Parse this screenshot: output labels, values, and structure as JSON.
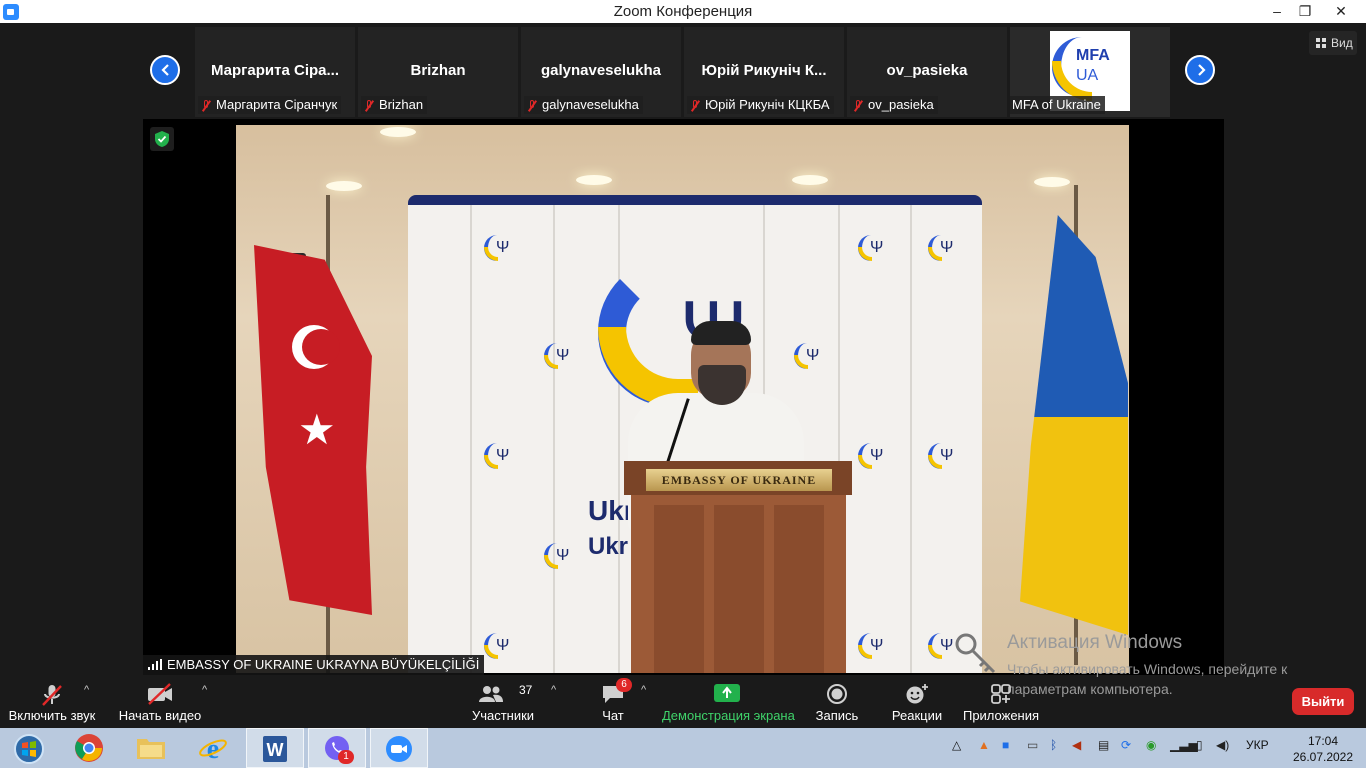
{
  "window": {
    "title": "Zoom Конференция",
    "minimize": "–",
    "maximize": "❐",
    "close": "✕"
  },
  "view_button": {
    "label": "Вид"
  },
  "thumbnails": [
    {
      "name": "Маргарита  Сіра...",
      "label": "Маргарита Сіранчук",
      "muted": true
    },
    {
      "name": "Brizhan",
      "label": "Brizhan",
      "muted": true
    },
    {
      "name": "galynaveselukha",
      "label": "galynaveselukha",
      "muted": true
    },
    {
      "name": "Юрій  Рикуніч  К...",
      "label": "Юрій Рикуніч КЦКБА",
      "muted": true
    },
    {
      "name": "ov_pasieka",
      "label": "ov_pasieka",
      "muted": true
    },
    {
      "name": "",
      "label": "MFA of Ukraine",
      "muted": false,
      "logo_text_1": "MFA",
      "logo_text_2": "UA"
    }
  ],
  "main_video": {
    "speaker_label": "EMBASSY OF UKRAINE UKRAYNA BÜYÜKELÇİLİĞİ",
    "podium_plate": "EMBASSY OF UKRAINE",
    "backdrop_text_1": "Ukra",
    "backdrop_text_1b": "Y",
    "backdrop_text_2": "Ukr"
  },
  "activation": {
    "title": "Активация Windows",
    "message": "Чтобы активировать Windows, перейдите к параметрам компьютера."
  },
  "toolbar": {
    "unmute": "Включить звук",
    "start_video": "Начать видео",
    "participants": "Участники",
    "participants_count": "37",
    "chat": "Чат",
    "chat_badge": "6",
    "share": "Демонстрация экрана",
    "record": "Запись",
    "reactions": "Реакции",
    "apps": "Приложения",
    "leave": "Выйти"
  },
  "taskbar": {
    "lang": "УКР",
    "time": "17:04",
    "date": "26.07.2022",
    "viber_badge": "1"
  },
  "colors": {
    "zoom_blue": "#2d8cff",
    "leave_red": "#d82a2a",
    "share_green": "#22b14c",
    "mute_red": "#e02828"
  }
}
